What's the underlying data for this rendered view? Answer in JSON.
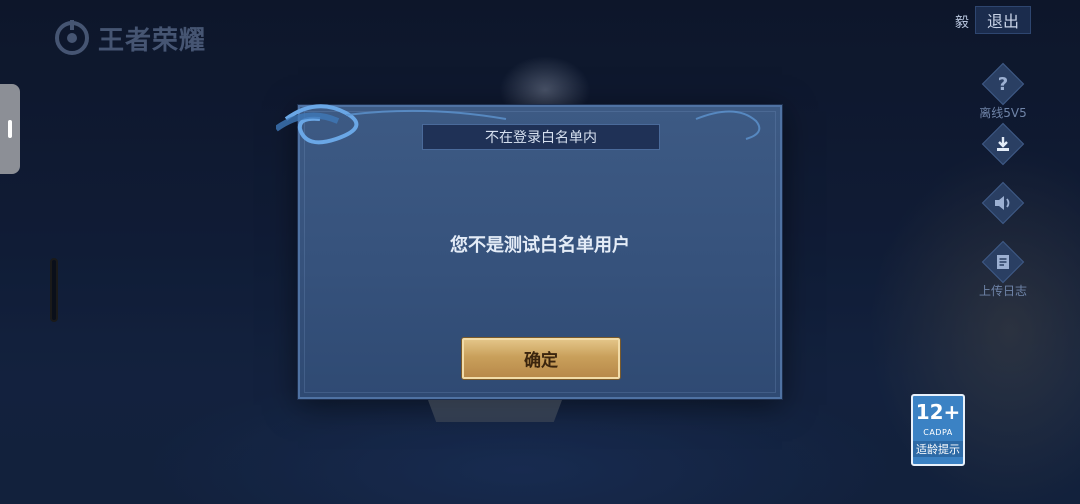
{
  "app": {
    "logo_text": "王者荣耀"
  },
  "top_bar": {
    "account_name": "毅",
    "exit_label": "退出"
  },
  "side_tools": [
    {
      "icon": "question-icon",
      "label": "离线5V5"
    },
    {
      "icon": "download-icon",
      "label": ""
    },
    {
      "icon": "speaker-icon",
      "label": ""
    },
    {
      "icon": "log-icon",
      "label": "上传日志"
    }
  ],
  "age_badge": {
    "age": "12+",
    "org": "CADPA",
    "tip": "适龄提示"
  },
  "dialog": {
    "title": "不在登录白名单内",
    "message": "您不是测试白名单用户",
    "confirm_label": "确定"
  },
  "colors": {
    "dialog_bg": "#3a5680",
    "confirm_gold": "#c9a05b",
    "age_badge_blue": "#3b82c4"
  }
}
